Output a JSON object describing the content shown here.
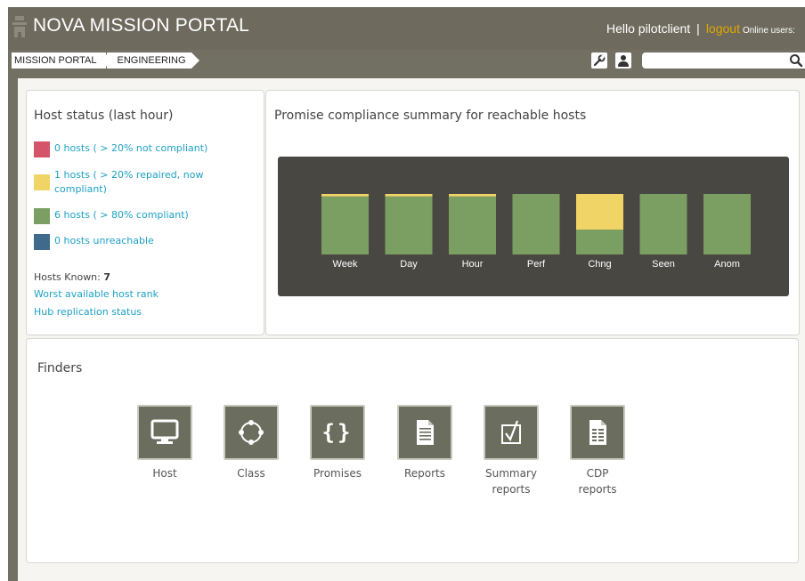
{
  "header": {
    "app_title": "NOVA MISSION PORTAL",
    "greeting": "Hello pilotclient",
    "separator": "|",
    "logout_label": "logout",
    "online_users_label": "Online users:"
  },
  "breadcrumb": [
    "MISSION PORTAL",
    "ENGINEERING"
  ],
  "search": {
    "placeholder": ""
  },
  "host_status": {
    "title": "Host status (last hour)",
    "items": [
      {
        "label": "0 hosts ( > 20% not compliant)",
        "color": "#d65469"
      },
      {
        "label": "1 hosts ( > 20% repaired, now compliant)",
        "color": "#f0d466"
      },
      {
        "label": "6 hosts ( > 80% compliant)",
        "color": "#7b9f63"
      },
      {
        "label": "0 hosts unreachable",
        "color": "#406a8c"
      }
    ],
    "hosts_known_label": "Hosts Known:",
    "hosts_known_value": "7",
    "links": [
      "Worst available host rank",
      "Hub replication status"
    ]
  },
  "compliance": {
    "title": "Promise compliance summary for reachable hosts"
  },
  "chart_data": {
    "type": "bar",
    "stacked": true,
    "categories": [
      "Week",
      "Day",
      "Hour",
      "Perf",
      "Chng",
      "Seen",
      "Anom"
    ],
    "series": [
      {
        "color": "#7b9f63",
        "values": [
          0.96,
          0.96,
          0.96,
          1.0,
          0.41,
          1.0,
          1.0
        ]
      },
      {
        "color": "#f0d466",
        "values": [
          0.04,
          0.04,
          0.04,
          0.0,
          0.59,
          0.0,
          0.0
        ]
      }
    ],
    "ylim": [
      0,
      1
    ],
    "background": "#484742"
  },
  "finders": {
    "title": "Finders",
    "items": [
      {
        "label": "Host",
        "icon": "monitor-icon"
      },
      {
        "label": "Class",
        "icon": "class-circle-icon"
      },
      {
        "label": "Promises",
        "icon": "braces-icon"
      },
      {
        "label": "Reports",
        "icon": "document-icon"
      },
      {
        "label": "Summary reports",
        "icon": "checkbox-icon"
      },
      {
        "label": "CDP reports",
        "icon": "cdp-document-icon"
      }
    ]
  }
}
